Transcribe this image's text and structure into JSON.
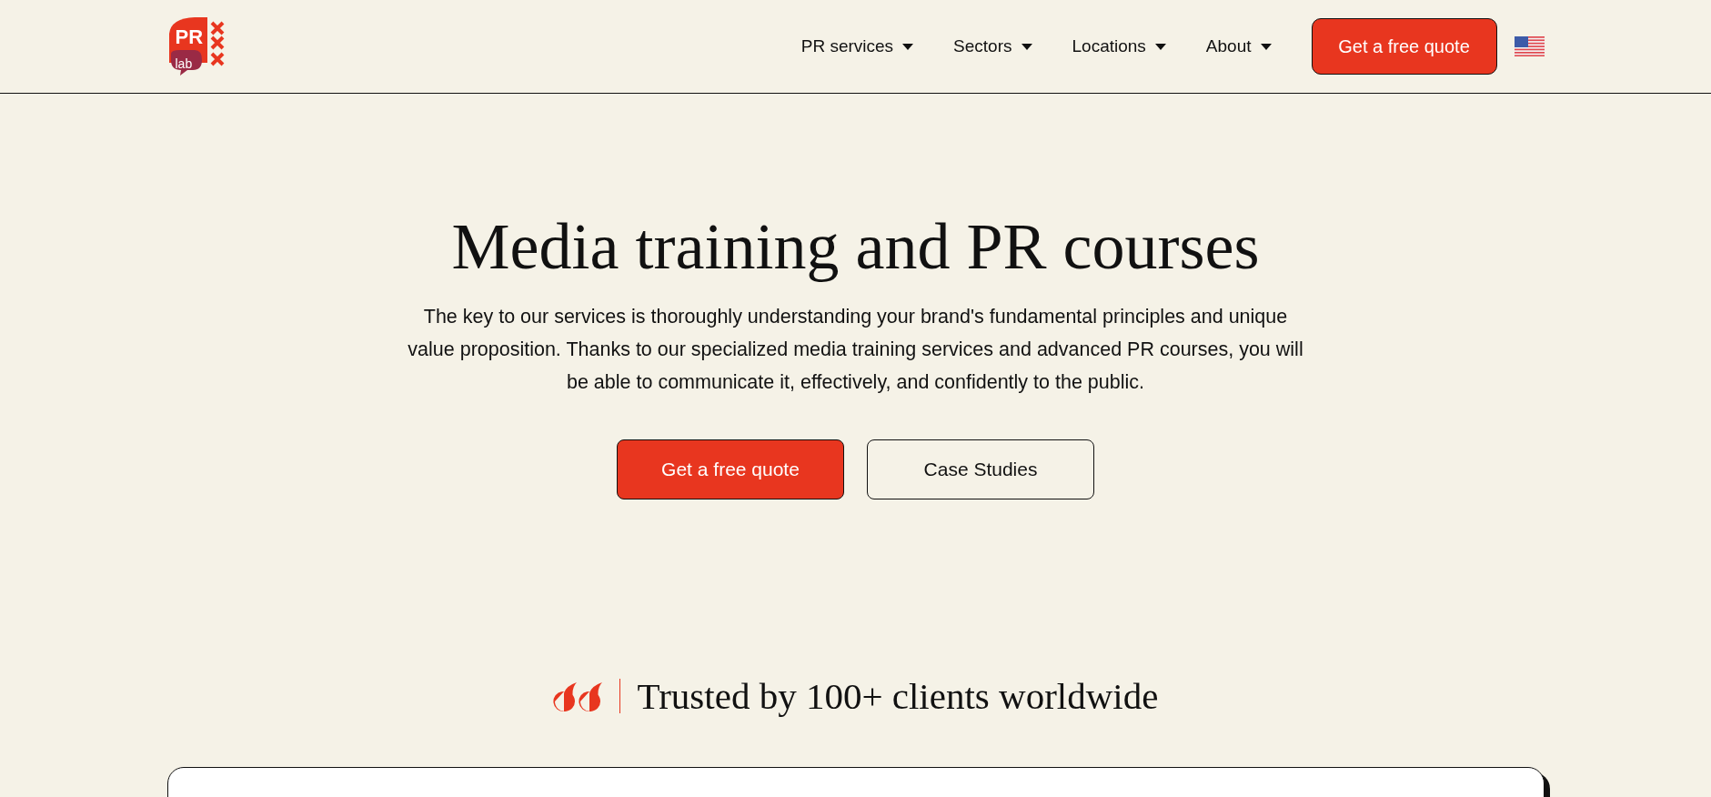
{
  "header": {
    "logo": {
      "text": "PR",
      "subtext": "lab"
    },
    "nav": [
      {
        "label": "PR services"
      },
      {
        "label": "Sectors"
      },
      {
        "label": "Locations"
      },
      {
        "label": "About"
      }
    ],
    "cta": "Get a free quote"
  },
  "hero": {
    "title": "Media training and PR courses",
    "text": "The key to our services is thoroughly understanding your brand's fundamental principles and unique value proposition. Thanks to our specialized media training services and advanced PR courses, you will be able to communicate it, effectively, and confidently to the public.",
    "buttons": [
      {
        "label": "Get a free quote",
        "kind": "primary"
      },
      {
        "label": "Case Studies",
        "kind": "secondary"
      }
    ]
  },
  "trust": {
    "text": "Trusted by 100+ clients worldwide"
  }
}
